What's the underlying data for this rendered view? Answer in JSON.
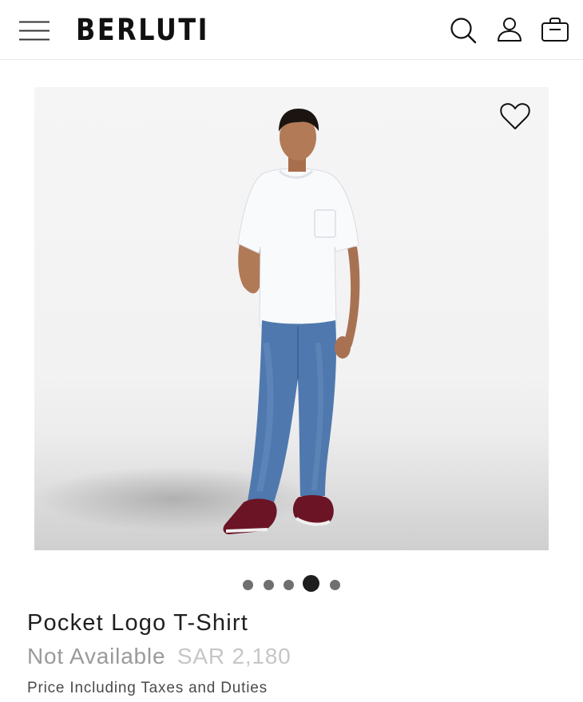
{
  "header": {
    "brand": "BERLUTI",
    "icons": {
      "menu": "hamburger-menu-icon",
      "search": "search-icon",
      "account": "user-icon",
      "bag": "shopping-bag-icon"
    }
  },
  "product": {
    "image_alt": "Model wearing white pocket t-shirt, blue jeans and burgundy sneakers",
    "wishlist_icon": "heart-icon",
    "carousel": {
      "total": 5,
      "active_index": 4
    },
    "title": "Pocket Logo T-Shirt",
    "availability": "Not Available",
    "price": "SAR 2,180",
    "tax_note": "Price Including Taxes and Duties"
  },
  "colors": {
    "text": "#1f1f1f",
    "muted": "#9a9a9a",
    "price_muted": "#c6c6c6",
    "dot": "#6f6f6f",
    "dot_active": "#1e1e1e"
  }
}
